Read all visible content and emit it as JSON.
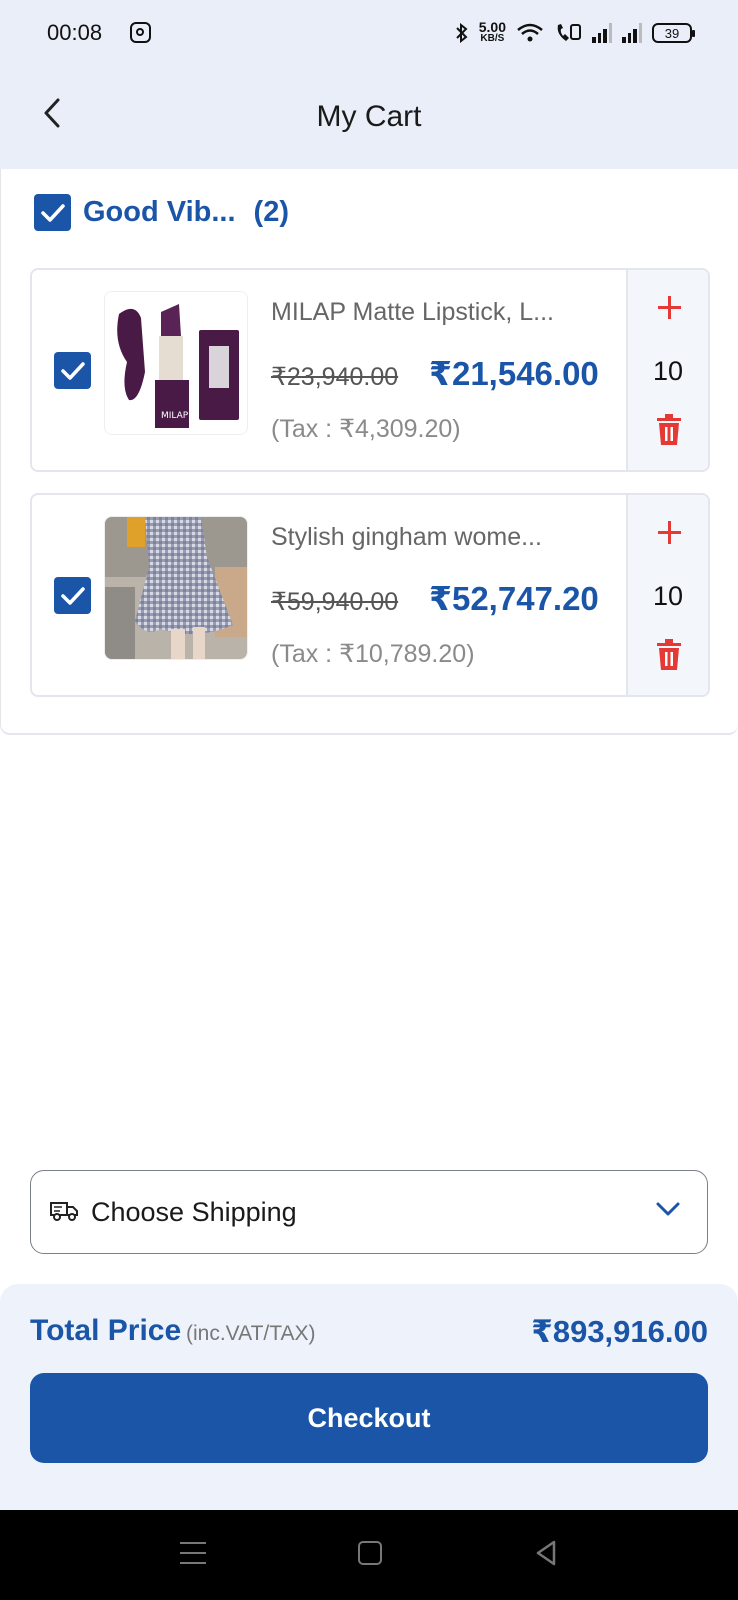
{
  "status_bar": {
    "time": "00:08",
    "speed_value": "5.00",
    "speed_unit": "KB/S",
    "battery": "39"
  },
  "header": {
    "title": "My Cart"
  },
  "store": {
    "name": "Good Vib...",
    "count": "(2)"
  },
  "items": [
    {
      "title": "MILAP Matte Lipstick, L...",
      "original_price": "₹23,940.00",
      "price": "₹21,546.00",
      "tax": "(Tax : ₹4,309.20)",
      "quantity": "10",
      "brand_mark": "MILAP"
    },
    {
      "title": "Stylish gingham wome...",
      "original_price": "₹59,940.00",
      "price": "₹52,747.20",
      "tax": "(Tax : ₹10,789.20)",
      "quantity": "10"
    }
  ],
  "shipping": {
    "label": "Choose Shipping"
  },
  "footer": {
    "total_label": "Total Price",
    "total_note": "(inc.VAT/TAX)",
    "total_value": "₹893,916.00",
    "checkout_label": "Checkout"
  },
  "colors": {
    "primary": "#1a55a8",
    "danger": "#e53935",
    "header_bg": "#e9eef9"
  },
  "icons": {
    "back": "chevron-left-icon",
    "check": "checkmark-icon",
    "add": "plus-icon",
    "delete": "trash-icon",
    "shipping": "truck-icon",
    "dropdown": "chevron-down-icon"
  }
}
